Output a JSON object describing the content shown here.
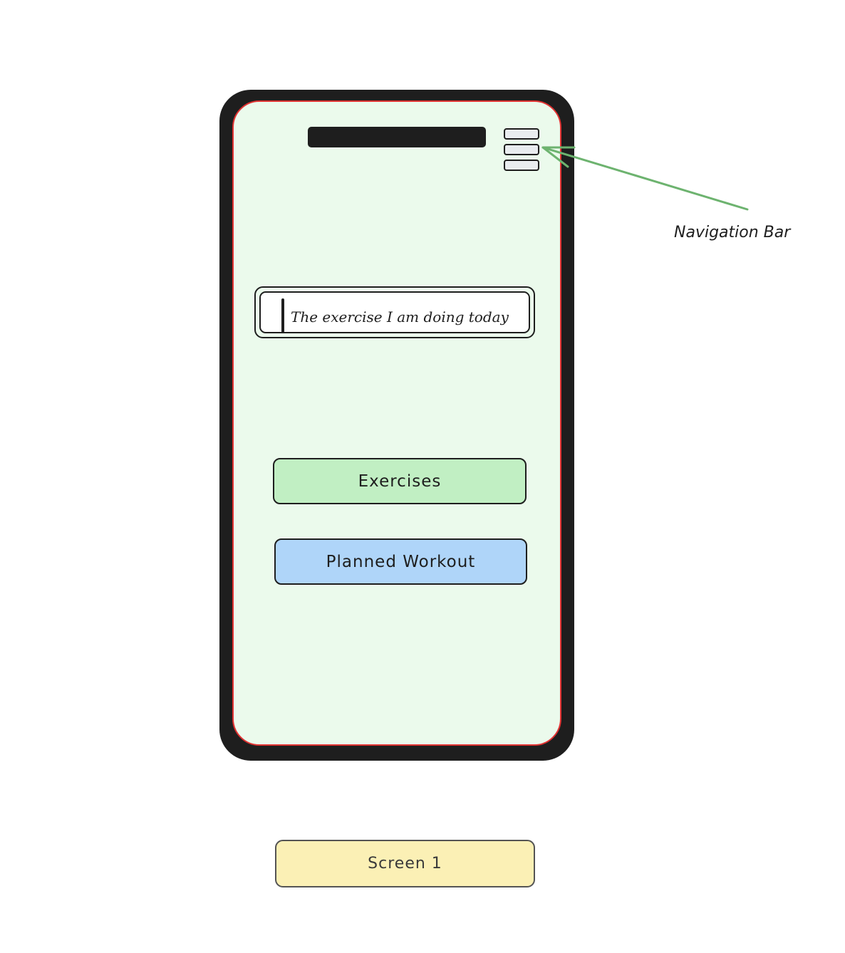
{
  "phone": {
    "search": {
      "placeholder": "The exercise I am doing today"
    },
    "buttons": {
      "exercises": "Exercises",
      "planned_workout": "Planned Workout"
    },
    "nav_icon": "hamburger-menu-icon"
  },
  "annotation": {
    "label": "Navigation Bar",
    "color": "#6db36f"
  },
  "screen_label": "Screen 1",
  "colors": {
    "frame": "#1e1e1e",
    "screen_bg": "#ebfaec",
    "screen_border": "#e03131",
    "exercises_bg": "#c1efc3",
    "planned_bg": "#afd5f9",
    "label_bg": "#fbf0b5"
  }
}
